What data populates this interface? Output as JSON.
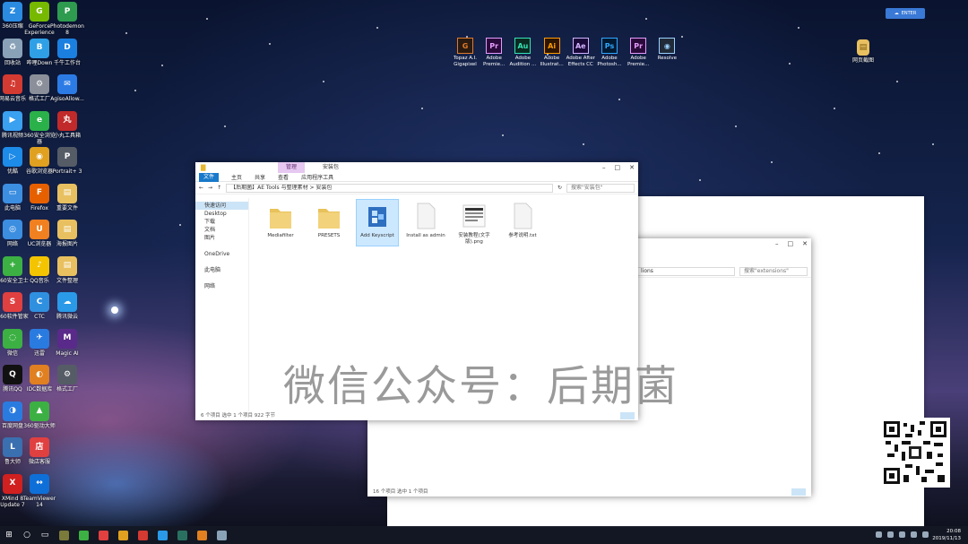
{
  "desktop": {
    "icons": [
      {
        "label": "360压缩",
        "color": "#2a8be0",
        "glyph": "Z"
      },
      {
        "label": "GeForce Experience",
        "color": "#76b900",
        "glyph": "G"
      },
      {
        "label": "Photodemon 8",
        "color": "#2e9b4f",
        "glyph": "P"
      },
      {
        "label": "回收站",
        "color": "#8aa2b8",
        "glyph": "♻"
      },
      {
        "label": "哔哩Down",
        "color": "#2fa0e6",
        "glyph": "B"
      },
      {
        "label": "千牛工作台",
        "color": "#1b7fe0",
        "glyph": "D"
      },
      {
        "label": "网易云音乐",
        "color": "#d33a31",
        "glyph": "♫"
      },
      {
        "label": "格式工厂",
        "color": "#8a8f99",
        "glyph": "⚙"
      },
      {
        "label": "AgisoAllow...",
        "color": "#2c7be5",
        "glyph": "✉"
      },
      {
        "label": "腾讯视频",
        "color": "#3aa0f0",
        "glyph": "▶"
      },
      {
        "label": "360安全浏览器",
        "color": "#2bb14a",
        "glyph": "e"
      },
      {
        "label": "小丸工具箱",
        "color": "#c02a2a",
        "glyph": "丸"
      },
      {
        "label": "优酷",
        "color": "#1d8be8",
        "glyph": "▷"
      },
      {
        "label": "谷歌浏览器",
        "color": "#e0a020",
        "glyph": "◉"
      },
      {
        "label": "Portrait+ 3",
        "color": "#555c66",
        "glyph": "P"
      },
      {
        "label": "此电脑",
        "color": "#3c8ee0",
        "glyph": "▭"
      },
      {
        "label": "Firefox",
        "color": "#e66000",
        "glyph": "F"
      },
      {
        "label": "重要文件",
        "color": "#e8c060",
        "glyph": "▤"
      },
      {
        "label": "网络",
        "color": "#3c8ee0",
        "glyph": "◎"
      },
      {
        "label": "UC浏览器",
        "color": "#f08020",
        "glyph": "U"
      },
      {
        "label": "海报图片",
        "color": "#e8c060",
        "glyph": "▤"
      },
      {
        "label": "360安全卫士",
        "color": "#3cb043",
        "glyph": "+"
      },
      {
        "label": "QQ音乐",
        "color": "#f5c400",
        "glyph": "♪"
      },
      {
        "label": "文件整理",
        "color": "#e8c060",
        "glyph": "▤"
      },
      {
        "label": "360软件管家",
        "color": "#e04040",
        "glyph": "S"
      },
      {
        "label": "CTC",
        "color": "#3090e0",
        "glyph": "C"
      },
      {
        "label": "腾讯微云",
        "color": "#2a9ae8",
        "glyph": "☁"
      },
      {
        "label": "微信",
        "color": "#3cb043",
        "glyph": "◌"
      },
      {
        "label": "迅雷",
        "color": "#2a7be0",
        "glyph": "✈"
      },
      {
        "label": "Magic AI",
        "color": "#5a2a8a",
        "glyph": "M"
      },
      {
        "label": "腾讯QQ",
        "color": "#111111",
        "glyph": "Q"
      },
      {
        "label": "IDC数据库",
        "color": "#e08020",
        "glyph": "◐"
      },
      {
        "label": "格式工厂",
        "color": "#555c66",
        "glyph": "⚙"
      },
      {
        "label": "百度网盘",
        "color": "#2a7be0",
        "glyph": "◑"
      },
      {
        "label": "360驱动大师",
        "color": "#3cb043",
        "glyph": "▲"
      },
      {
        "label": "",
        "color": "",
        "glyph": ""
      },
      {
        "label": "鲁大师",
        "color": "#3a6fb0",
        "glyph": "L"
      },
      {
        "label": "微店客服",
        "color": "#e04040",
        "glyph": "店"
      },
      {
        "label": "",
        "color": "",
        "glyph": ""
      },
      {
        "label": "XMind 8 Update 7",
        "color": "#d02020",
        "glyph": "X"
      },
      {
        "label": "TeamViewer 14",
        "color": "#0e6fd8",
        "glyph": "↔"
      },
      {
        "label": "",
        "color": "",
        "glyph": ""
      }
    ],
    "adobe_apps": [
      {
        "label": "Topaz A.I. Gigapixel",
        "abbr": "G",
        "color": "#e07a2a",
        "bg": "#2a1a10"
      },
      {
        "label": "Adobe Premie...",
        "abbr": "Pr",
        "color": "#e59bff",
        "bg": "#2a0a3a"
      },
      {
        "label": "Adobe Audition ...",
        "abbr": "Au",
        "color": "#36e3b4",
        "bg": "#0a2a22"
      },
      {
        "label": "Adobe Illustrat...",
        "abbr": "Ai",
        "color": "#ff9a00",
        "bg": "#2e1500"
      },
      {
        "label": "Adobe After Effects CC",
        "abbr": "Ae",
        "color": "#d3b3ff",
        "bg": "#1a0a3a"
      },
      {
        "label": "Adobe Photosh...",
        "abbr": "Ps",
        "color": "#31a8ff",
        "bg": "#001a33"
      },
      {
        "label": "Adobe Premie...",
        "abbr": "Pr",
        "color": "#e59bff",
        "bg": "#2a0a3a"
      },
      {
        "label": "Resolve",
        "abbr": "◉",
        "color": "#9bd1ff",
        "bg": "#202a38"
      }
    ],
    "right_icon_label": "网页截图",
    "top_badge": "ENTER"
  },
  "explorer_front": {
    "contextual_tab": "管理",
    "tab_title": "安装包",
    "ribbon_tabs": [
      "文件",
      "主页",
      "共享",
      "查看",
      "应用程序工具"
    ],
    "path": "【后期菌】AE Tools 与整理素材 > 安装包",
    "search_placeholder": "搜索\"安装包\"",
    "nav_items": [
      {
        "label": "快速访问",
        "selected": true
      },
      {
        "label": "Desktop",
        "selected": false
      },
      {
        "label": "下载",
        "selected": false
      },
      {
        "label": "文档",
        "selected": false
      },
      {
        "label": "图片",
        "selected": false
      },
      {
        "label": "",
        "selected": false
      },
      {
        "label": "OneDrive",
        "selected": false
      },
      {
        "label": "",
        "selected": false
      },
      {
        "label": "此电脑",
        "selected": false
      },
      {
        "label": "",
        "selected": false
      },
      {
        "label": "网络",
        "selected": false
      }
    ],
    "files": [
      {
        "name": "Mediafilter",
        "type": "folder",
        "selected": false
      },
      {
        "name": "PRESETS",
        "type": "folder",
        "selected": false
      },
      {
        "name": "Add Keyscript",
        "type": "app",
        "selected": true
      },
      {
        "name": "Install as admin",
        "type": "doc",
        "selected": false
      },
      {
        "name": "安装教程(文字版).png",
        "type": "image",
        "selected": false
      },
      {
        "name": "参考说明.txt",
        "type": "doc",
        "selected": false
      }
    ],
    "status": "6 个项目    选中 1 个项目  922 字节"
  },
  "explorer_back": {
    "path": "lions",
    "search_placeholder": "搜索\"extensions\"",
    "status": "16 个项目   选中 1 个项目"
  },
  "watermark": "微信公众号：后期菌",
  "taskbar": {
    "time": "20:08",
    "date": "2019/11/13",
    "apps": [
      {
        "color": "#7a7a3a"
      },
      {
        "color": "#3cb043"
      },
      {
        "color": "#e04040"
      },
      {
        "color": "#e0a020"
      },
      {
        "color": "#d33a31"
      },
      {
        "color": "#2a9ae8"
      },
      {
        "color": "#2a7060"
      },
      {
        "color": "#e08020"
      },
      {
        "color": "#8aa2b8"
      }
    ]
  }
}
